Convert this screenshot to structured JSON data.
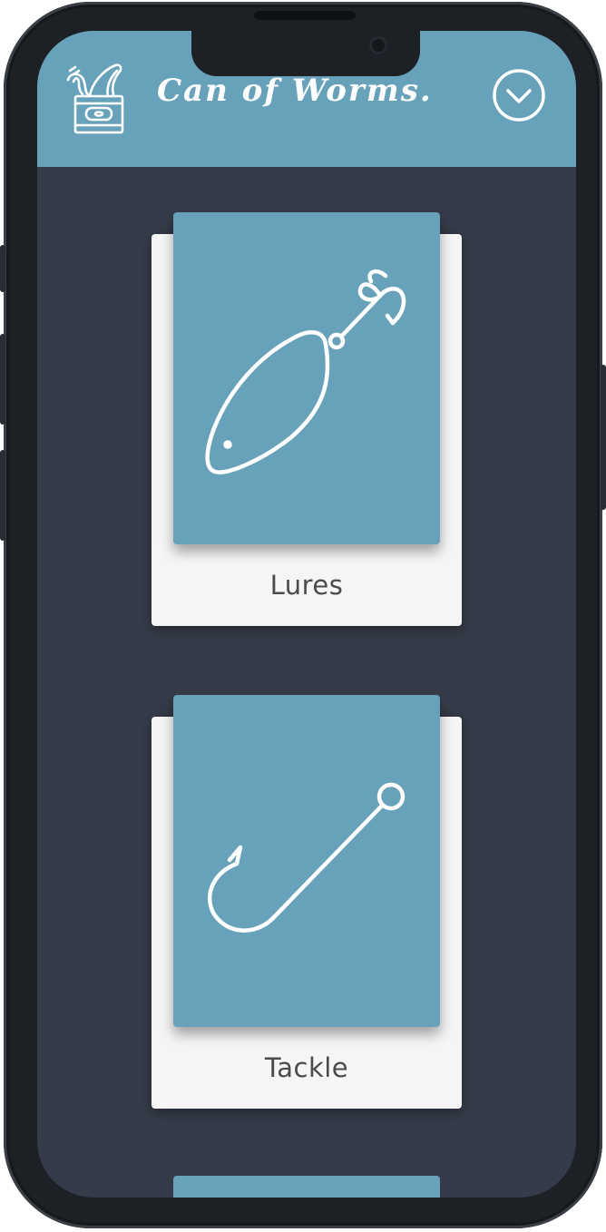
{
  "header": {
    "title": "Can of Worms.",
    "logo_icon": "can-of-worms-icon",
    "menu_icon": "chevron-down-circle-icon"
  },
  "categories": [
    {
      "label": "Lures",
      "icon": "fishing-lure-icon"
    },
    {
      "label": "Tackle",
      "icon": "fish-hook-icon"
    }
  ],
  "colors": {
    "accent": "#67a2ba",
    "background": "#353b48",
    "card": "#f5f5f5",
    "label_text": "#4b4b4b"
  }
}
